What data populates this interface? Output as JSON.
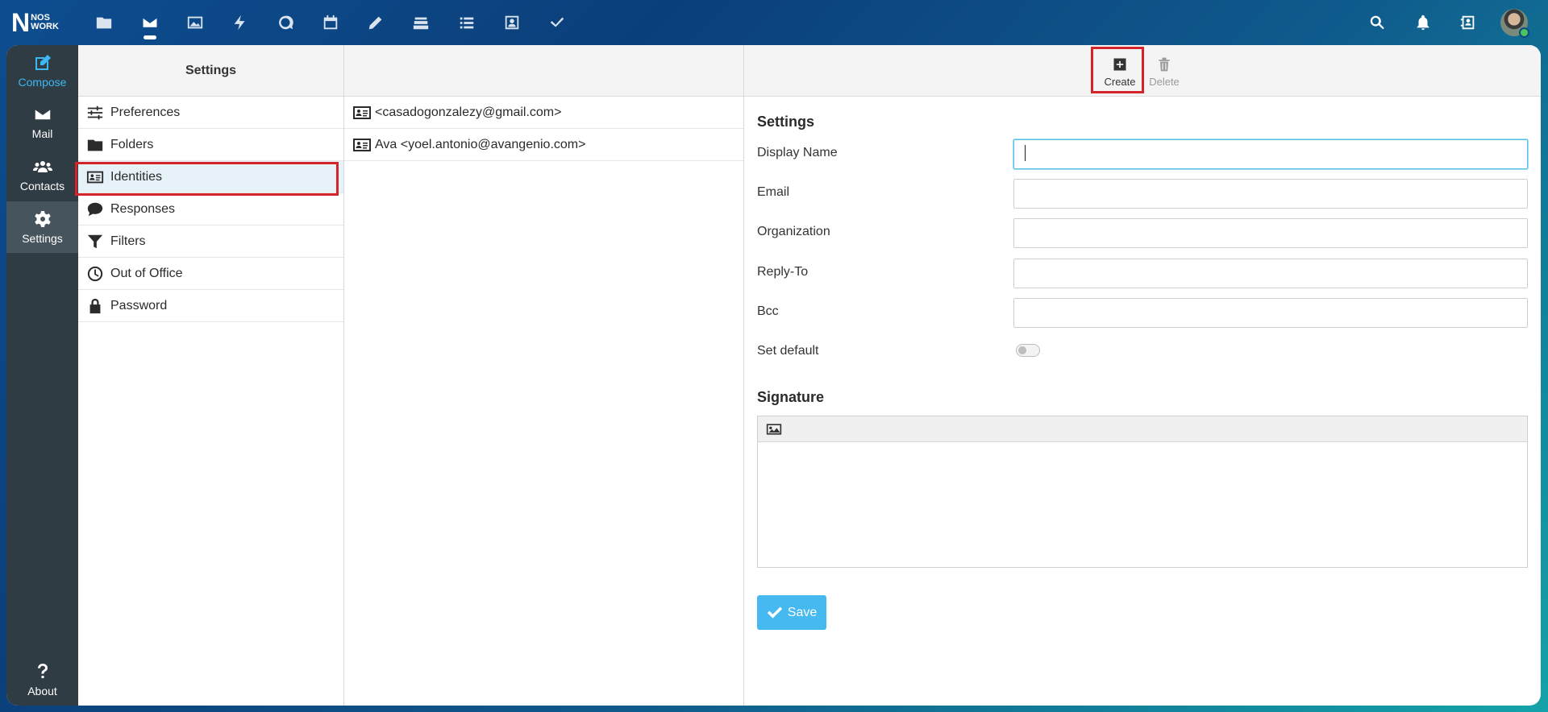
{
  "logo": {
    "mark": "N",
    "line1": "NOS",
    "line2": "WORK"
  },
  "topbar": {
    "apps": [
      "folder-icon",
      "mail-icon",
      "image-icon",
      "bolt-icon",
      "chat-icon",
      "calendar-icon",
      "pencil-icon",
      "stack-icon",
      "list-icon",
      "contact-card-icon",
      "check-icon"
    ],
    "active_app": "mail-icon",
    "right": [
      "search-icon",
      "bell-icon",
      "address-book-icon",
      "avatar"
    ]
  },
  "leftnav": {
    "compose": "Compose",
    "mail": "Mail",
    "contacts": "Contacts",
    "settings": "Settings",
    "about": "About"
  },
  "settings_menu": {
    "header": "Settings",
    "items": [
      {
        "label": "Preferences",
        "icon": "sliders-icon"
      },
      {
        "label": "Folders",
        "icon": "folder-icon"
      },
      {
        "label": "Identities",
        "icon": "id-card-icon"
      },
      {
        "label": "Responses",
        "icon": "speech-bubble-icon"
      },
      {
        "label": "Filters",
        "icon": "funnel-icon"
      },
      {
        "label": "Out of Office",
        "icon": "clock-icon"
      },
      {
        "label": "Password",
        "icon": "lock-icon"
      }
    ],
    "selected": "Identities"
  },
  "identities": {
    "items": [
      {
        "label": "<casadogonzalezy@gmail.com>"
      },
      {
        "label": "Ava <yoel.antonio@avangenio.com>"
      }
    ]
  },
  "toolbar": {
    "create": "Create",
    "delete": "Delete"
  },
  "form": {
    "section_title": "Settings",
    "display_name_label": "Display Name",
    "display_name_value": "",
    "email_label": "Email",
    "email_value": "",
    "organization_label": "Organization",
    "organization_value": "",
    "reply_to_label": "Reply-To",
    "reply_to_value": "",
    "bcc_label": "Bcc",
    "bcc_value": "",
    "set_default_label": "Set default",
    "set_default_on": false,
    "signature_title": "Signature",
    "save_label": "Save"
  },
  "colors": {
    "accent": "#45b9f0",
    "nav_bg": "#2f3c44",
    "highlight_box": "#d4242a",
    "selected_row": "#e6f1f8"
  }
}
